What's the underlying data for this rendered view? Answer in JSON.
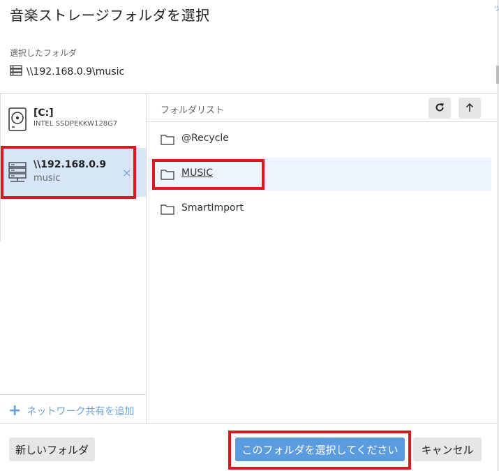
{
  "dialog": {
    "title": "音楽ストレージフォルダを選択",
    "selected_caption": "選択したフォルダ",
    "selected_path": "\\\\192.168.0.9\\music"
  },
  "sidebar": {
    "drives": [
      {
        "name": "[C:]",
        "subtitle": "INTEL SSDPEKKW128G7",
        "icon": "hard-drive-icon"
      },
      {
        "name": "\\\\192.168.0.9",
        "subtitle": "music",
        "icon": "network-server-icon",
        "selected": true,
        "remove_glyph": "×"
      }
    ],
    "add_share_label": "ネットワーク共有を追加",
    "add_share_icon": "plus-icon"
  },
  "folder_list": {
    "title": "フォルダリスト",
    "refresh_icon": "refresh-icon",
    "up_icon": "arrow-up-icon",
    "items": [
      {
        "label": "@Recycle"
      },
      {
        "label": "MUSIC",
        "selected": true
      },
      {
        "label": "SmartImport"
      }
    ]
  },
  "footer": {
    "new_folder_label": "新しいフォルダ",
    "select_label": "このフォルダを選択してください",
    "cancel_label": "キャンセル"
  },
  "edge": {
    "glyph": "ツ"
  },
  "colors": {
    "accent": "#5b9bdf",
    "selection_bg": "#d6e6f6",
    "highlight_red": "#e0161e",
    "link_blue": "#6aa0d8"
  }
}
